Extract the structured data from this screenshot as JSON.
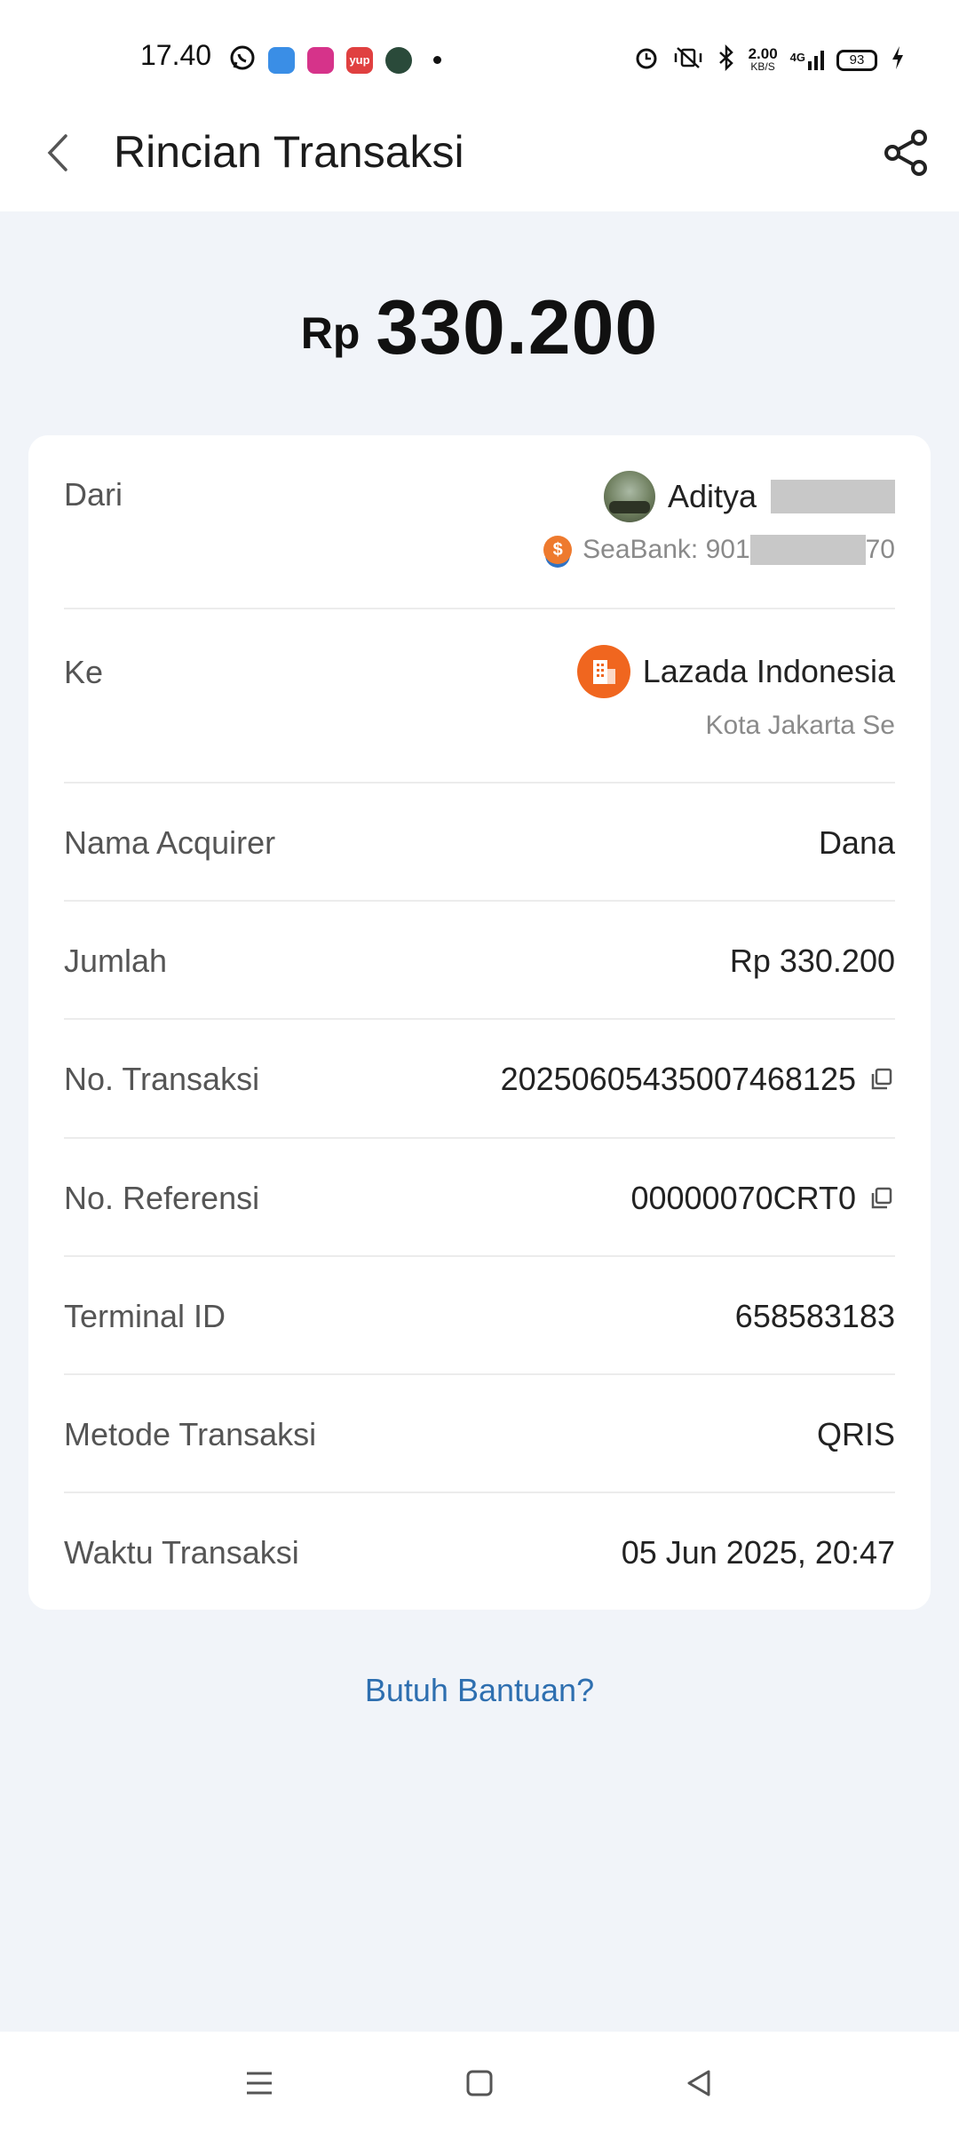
{
  "status_bar": {
    "time": "17.40",
    "app_icons": [
      "whatsapp-icon",
      "app-blue-icon",
      "app-pink-icon",
      "app-yup-icon",
      "app-green-icon"
    ],
    "yup_label": "yup",
    "speed_value": "2.00",
    "speed_unit": "KB/S",
    "network": "4G",
    "battery": "93",
    "colors": {
      "whatsapp": "#111111",
      "app_blue": "#3a8ee6",
      "app_pink": "#d6338a",
      "app_yup": "#e04040",
      "app_green": "#2a4a3a"
    }
  },
  "header": {
    "title": "Rincian Transaksi"
  },
  "amount": {
    "currency": "Rp",
    "value": "330.200"
  },
  "details": {
    "from": {
      "label": "Dari",
      "name": "Aditya",
      "bank_prefix": "SeaBank: 901",
      "bank_suffix": "70"
    },
    "to": {
      "label": "Ke",
      "name": "Lazada Indonesia",
      "location": "Kota Jakarta Se"
    },
    "rows": [
      {
        "label": "Nama Acquirer",
        "value": "Dana"
      },
      {
        "label": "Jumlah",
        "value": "Rp 330.200"
      },
      {
        "label": "No. Transaksi",
        "value": "20250605435007468125"
      },
      {
        "label": "No. Referensi",
        "value": "00000070CRT0"
      },
      {
        "label": "Terminal ID",
        "value": "658583183"
      },
      {
        "label": "Metode Transaksi",
        "value": "QRIS"
      },
      {
        "label": "Waktu Transaksi",
        "value": "05 Jun 2025, 20:47"
      }
    ]
  },
  "help": {
    "label": "Butuh Bantuan?"
  },
  "colors": {
    "background": "#f1f4f9",
    "card": "#ffffff",
    "link": "#2e6fb0",
    "merchant_icon": "#f0661f",
    "seabank_icon": "#ee7a2e"
  }
}
